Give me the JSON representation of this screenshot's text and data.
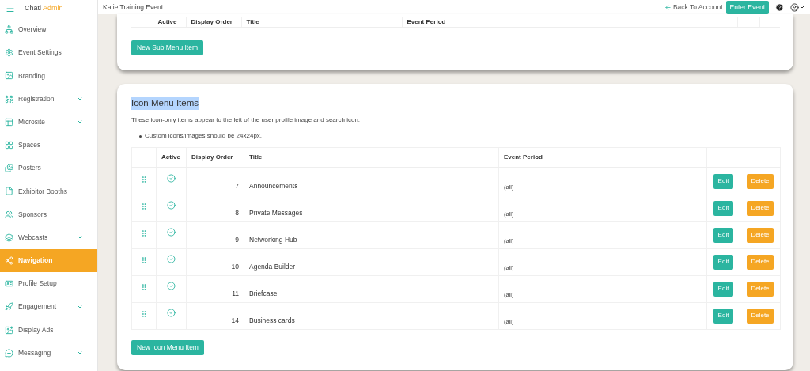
{
  "brand": {
    "name": "Chati",
    "suffix": "Admin"
  },
  "topbar": {
    "event_title": "Katie Training Event",
    "back_link": "Back To Account",
    "enter_button": "Enter Event"
  },
  "sidebar": {
    "items": [
      {
        "label": "Overview",
        "has_submenu": false,
        "selected": false
      },
      {
        "label": "Event Settings",
        "has_submenu": false,
        "selected": false
      },
      {
        "label": "Branding",
        "has_submenu": false,
        "selected": false
      },
      {
        "label": "Registration",
        "has_submenu": true,
        "selected": false
      },
      {
        "label": "Microsite",
        "has_submenu": true,
        "selected": false
      },
      {
        "label": "Spaces",
        "has_submenu": false,
        "selected": false
      },
      {
        "label": "Posters",
        "has_submenu": false,
        "selected": false
      },
      {
        "label": "Exhibitor Booths",
        "has_submenu": false,
        "selected": false
      },
      {
        "label": "Sponsors",
        "has_submenu": false,
        "selected": false
      },
      {
        "label": "Webcasts",
        "has_submenu": true,
        "selected": false
      },
      {
        "label": "Navigation",
        "has_submenu": false,
        "selected": true
      },
      {
        "label": "Profile Setup",
        "has_submenu": false,
        "selected": false
      },
      {
        "label": "Engagement",
        "has_submenu": true,
        "selected": false
      },
      {
        "label": "Display Ads",
        "has_submenu": false,
        "selected": false
      },
      {
        "label": "Messaging",
        "has_submenu": true,
        "selected": false
      }
    ]
  },
  "sub_menu_section": {
    "columns": [
      "Active",
      "Display Order",
      "Title",
      "Event Period"
    ],
    "new_button": "New Sub Menu Item"
  },
  "icon_menu_section": {
    "heading": "Icon Menu Items",
    "heading_highlighted": true,
    "description": "These icon-only items appear to the left of the user profile image and search icon.",
    "bullets": [
      "Custom icons/images should be 24x24px."
    ],
    "columns": [
      "Active",
      "Display Order",
      "Title",
      "Event Period"
    ],
    "rows": [
      {
        "active": true,
        "order": "7",
        "title": "Announcements",
        "period": "(all)",
        "edit": "Edit",
        "delete": "Delete"
      },
      {
        "active": true,
        "order": "8",
        "title": "Private Messages",
        "period": "(all)",
        "edit": "Edit",
        "delete": "Delete"
      },
      {
        "active": true,
        "order": "9",
        "title": "Networking Hub",
        "period": "(all)",
        "edit": "Edit",
        "delete": "Delete"
      },
      {
        "active": true,
        "order": "10",
        "title": "Agenda Builder",
        "period": "(all)",
        "edit": "Edit",
        "delete": "Delete"
      },
      {
        "active": true,
        "order": "11",
        "title": "Briefcase",
        "period": "(all)",
        "edit": "Edit",
        "delete": "Delete"
      },
      {
        "active": true,
        "order": "14",
        "title": "Business cards",
        "period": "(all)",
        "edit": "Edit",
        "delete": "Delete"
      }
    ],
    "new_button": "New Icon Menu Item"
  }
}
